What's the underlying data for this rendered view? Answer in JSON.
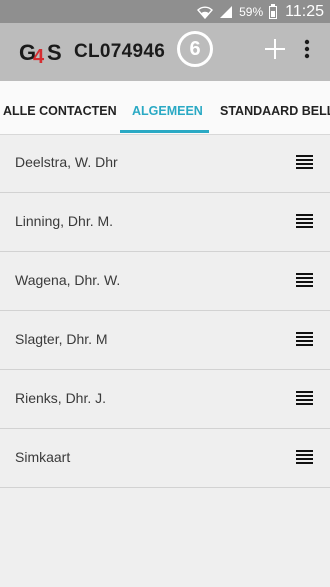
{
  "status_bar": {
    "battery_percent": "59%",
    "time": "11:25",
    "icons": [
      "wifi-icon",
      "signal-icon",
      "battery-icon"
    ]
  },
  "app_bar": {
    "logo_text": "G4S",
    "title": "CL074946",
    "badge_count": "6",
    "actions": [
      "add-icon",
      "more-vert-icon"
    ]
  },
  "tabs": [
    {
      "label": "ALLE CONTACTEN",
      "active": false
    },
    {
      "label": "ALGEMEEN",
      "active": true
    },
    {
      "label": "STANDAARD BELLI",
      "active": false
    }
  ],
  "contacts": [
    {
      "name": "Deelstra, W. Dhr"
    },
    {
      "name": "Linning, Dhr. M."
    },
    {
      "name": "Wagena, Dhr. W."
    },
    {
      "name": "Slagter, Dhr. M"
    },
    {
      "name": "Rienks, Dhr. J."
    },
    {
      "name": "Simkaart"
    }
  ],
  "colors": {
    "accent": "#2aa9c4",
    "app_bar": "#bcbcbc",
    "status_bar": "#8f8f8f",
    "logo_red": "#d7262a"
  }
}
